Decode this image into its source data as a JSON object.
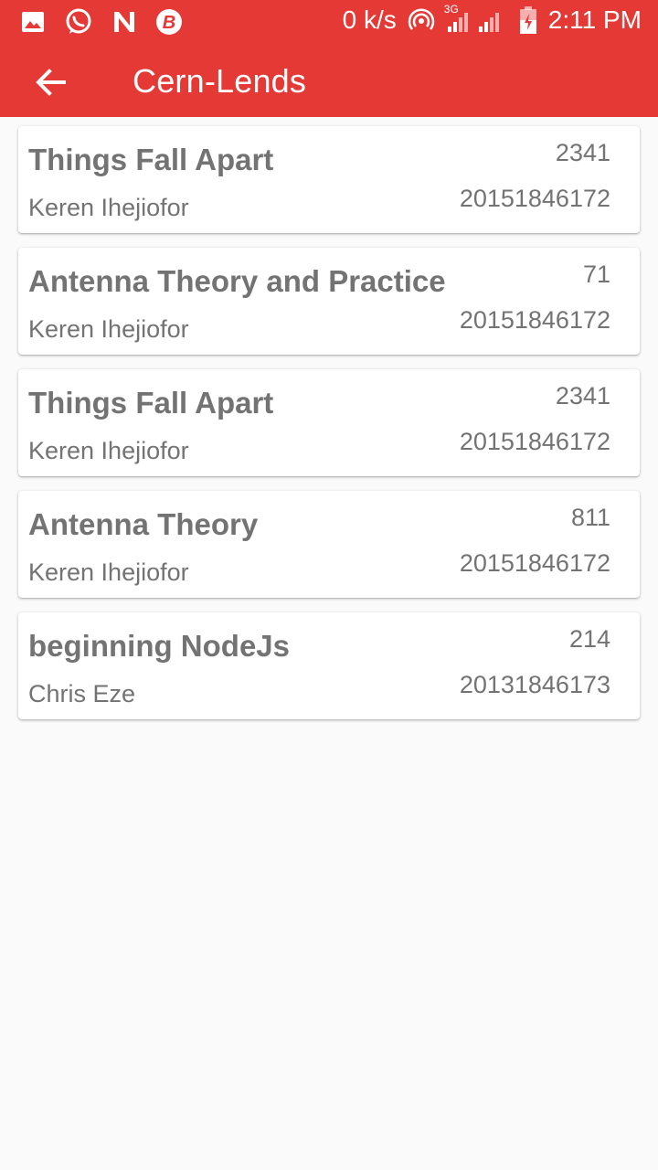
{
  "status_bar": {
    "speed": "0 k/s",
    "network": "3G",
    "time": "2:11 PM",
    "icons": [
      "image-icon",
      "whatsapp-icon",
      "n-icon",
      "b-icon",
      "hotspot-icon",
      "signal-icon",
      "battery-icon"
    ]
  },
  "toolbar": {
    "title": "Cern-Lends",
    "back_icon": "arrow-back-icon",
    "color": "#e53935"
  },
  "loans": [
    {
      "title": "Things Fall Apart",
      "count": "2341",
      "borrower": "Keren Ihejiofor",
      "reg_no": "20151846172"
    },
    {
      "title": "Antenna Theory and Practice",
      "count": "71",
      "borrower": "Keren Ihejiofor",
      "reg_no": "20151846172"
    },
    {
      "title": "Things Fall Apart",
      "count": "2341",
      "borrower": "Keren Ihejiofor",
      "reg_no": "20151846172"
    },
    {
      "title": "Antenna Theory",
      "count": "811",
      "borrower": "Keren Ihejiofor",
      "reg_no": "20151846172"
    },
    {
      "title": "beginning NodeJs",
      "count": "214",
      "borrower": "Chris Eze",
      "reg_no": "20131846173"
    }
  ]
}
